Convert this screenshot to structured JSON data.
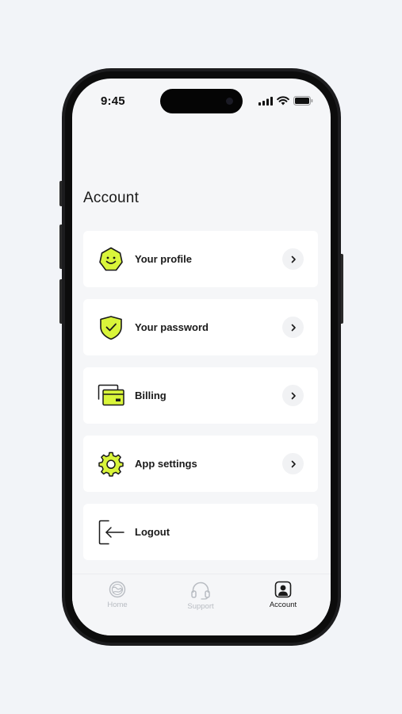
{
  "status_bar": {
    "time": "9:45"
  },
  "page": {
    "title": "Account"
  },
  "menu": {
    "items": [
      {
        "label": "Your profile",
        "icon": "smiley-icon",
        "has_chevron": true
      },
      {
        "label": "Your password",
        "icon": "shield-check-icon",
        "has_chevron": true
      },
      {
        "label": "Billing",
        "icon": "credit-card-icon",
        "has_chevron": true
      },
      {
        "label": "App settings",
        "icon": "gear-icon",
        "has_chevron": true
      },
      {
        "label": "Logout",
        "icon": "logout-icon",
        "has_chevron": false
      }
    ]
  },
  "tabbar": {
    "tabs": [
      {
        "label": "Home",
        "icon": "globe-icon",
        "active": false
      },
      {
        "label": "Support",
        "icon": "headset-icon",
        "active": false
      },
      {
        "label": "Account",
        "icon": "account-icon",
        "active": true
      }
    ]
  },
  "colors": {
    "accent": "#d9f53a",
    "icon_stroke": "#1a1a1a",
    "background": "#f5f6f8",
    "card": "#ffffff",
    "inactive_tab": "#b8bcc2"
  }
}
